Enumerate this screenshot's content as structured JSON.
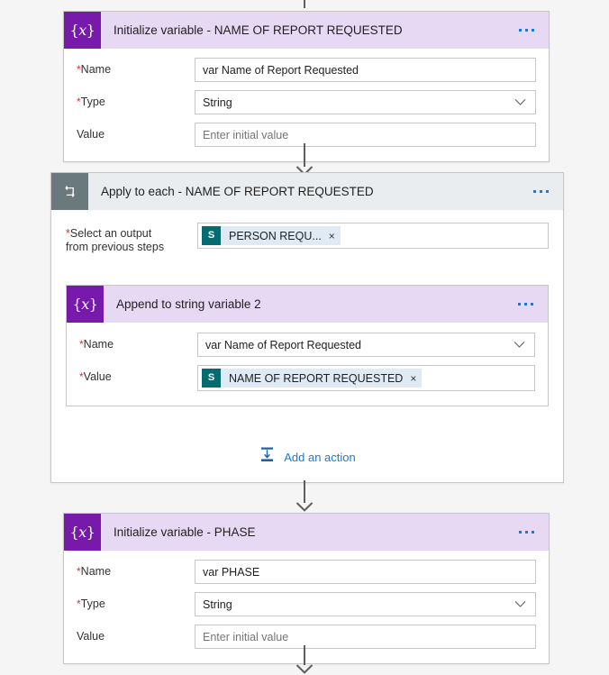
{
  "flow": {
    "steps": [
      {
        "id": "initialize-variable-name-of-report",
        "icon": "variable-braces-icon",
        "title": "Initialize variable - NAME OF REPORT REQUESTED",
        "menu_label": "More commands",
        "fields": [
          {
            "label": "Name",
            "required": true,
            "value": "var Name of Report Requested",
            "type": "text"
          },
          {
            "label": "Type",
            "required": true,
            "value": "String",
            "type": "dropdown"
          },
          {
            "label": "Value",
            "required": false,
            "value": "",
            "placeholder": "Enter initial value",
            "type": "text"
          }
        ]
      },
      {
        "id": "apply-to-each-name-of-report",
        "icon": "loop-repeat-icon",
        "title": "Apply to each - NAME OF REPORT REQUESTED",
        "menu_label": "More commands",
        "select_output": {
          "label_line1": "Select an output",
          "label_line2": "from previous steps",
          "required": true,
          "token": {
            "icon": "sharepoint-icon",
            "icon_letter": "S",
            "label": "PERSON REQU...",
            "remove_label": "×"
          }
        },
        "nested_step": {
          "id": "append-to-string-variable-2",
          "icon": "variable-braces-icon",
          "title": "Append to string variable 2",
          "menu_label": "More commands",
          "fields": [
            {
              "label": "Name",
              "required": true,
              "value": "var Name of Report Requested",
              "type": "dropdown"
            },
            {
              "label": "Value",
              "required": true,
              "type": "token",
              "token": {
                "icon": "sharepoint-icon",
                "icon_letter": "S",
                "label": "NAME OF REPORT REQUESTED",
                "remove_label": "×"
              }
            }
          ]
        },
        "add_action": {
          "icon": "insert-action-icon",
          "label": "Add an action"
        }
      },
      {
        "id": "initialize-variable-phase",
        "icon": "variable-braces-icon",
        "title": "Initialize variable - PHASE",
        "menu_label": "More commands",
        "fields": [
          {
            "label": "Name",
            "required": true,
            "value": "var PHASE",
            "type": "text"
          },
          {
            "label": "Type",
            "required": true,
            "value": "String",
            "type": "dropdown"
          },
          {
            "label": "Value",
            "required": false,
            "value": "",
            "placeholder": "Enter initial value",
            "type": "text"
          }
        ]
      }
    ]
  },
  "theme": {
    "page_background": "#f5f5f5",
    "variable_accent": "#7719aa",
    "variable_header": "#e7d9f4",
    "loop_accent": "#69797e",
    "loop_header": "#e9edf0",
    "link_blue": "#1b7ad1",
    "required_red": "#d13438",
    "sharepoint_teal": "#036c70",
    "connector_gray": "#605e5c"
  },
  "glyphs": {
    "variable_braces": "{x}",
    "ellipsis_dot": "•"
  }
}
